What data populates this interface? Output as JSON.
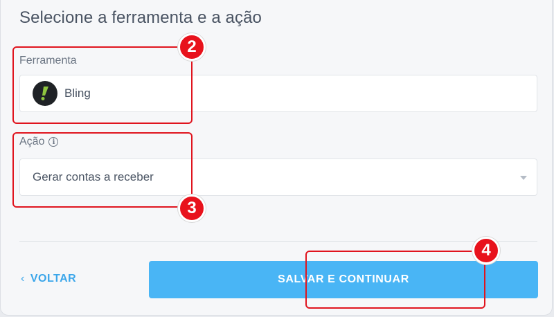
{
  "section": {
    "title": "Selecione a ferramenta e a ação"
  },
  "tool_field": {
    "label": "Ferramenta",
    "value": "Bling",
    "logo_icon": "bling-logo-icon",
    "logo_color": "#8fc63f"
  },
  "action_field": {
    "label": "Ação",
    "info_icon": "info-icon",
    "value": "Gerar contas a receber"
  },
  "footer": {
    "back_label": "VOLTAR",
    "save_label": "SALVAR E CONTINUAR"
  },
  "annotations": [
    {
      "number": "2"
    },
    {
      "number": "3"
    },
    {
      "number": "4"
    }
  ],
  "colors": {
    "primary": "#49b5f5",
    "link": "#3ba6ea",
    "annotation": "#e8121c"
  }
}
